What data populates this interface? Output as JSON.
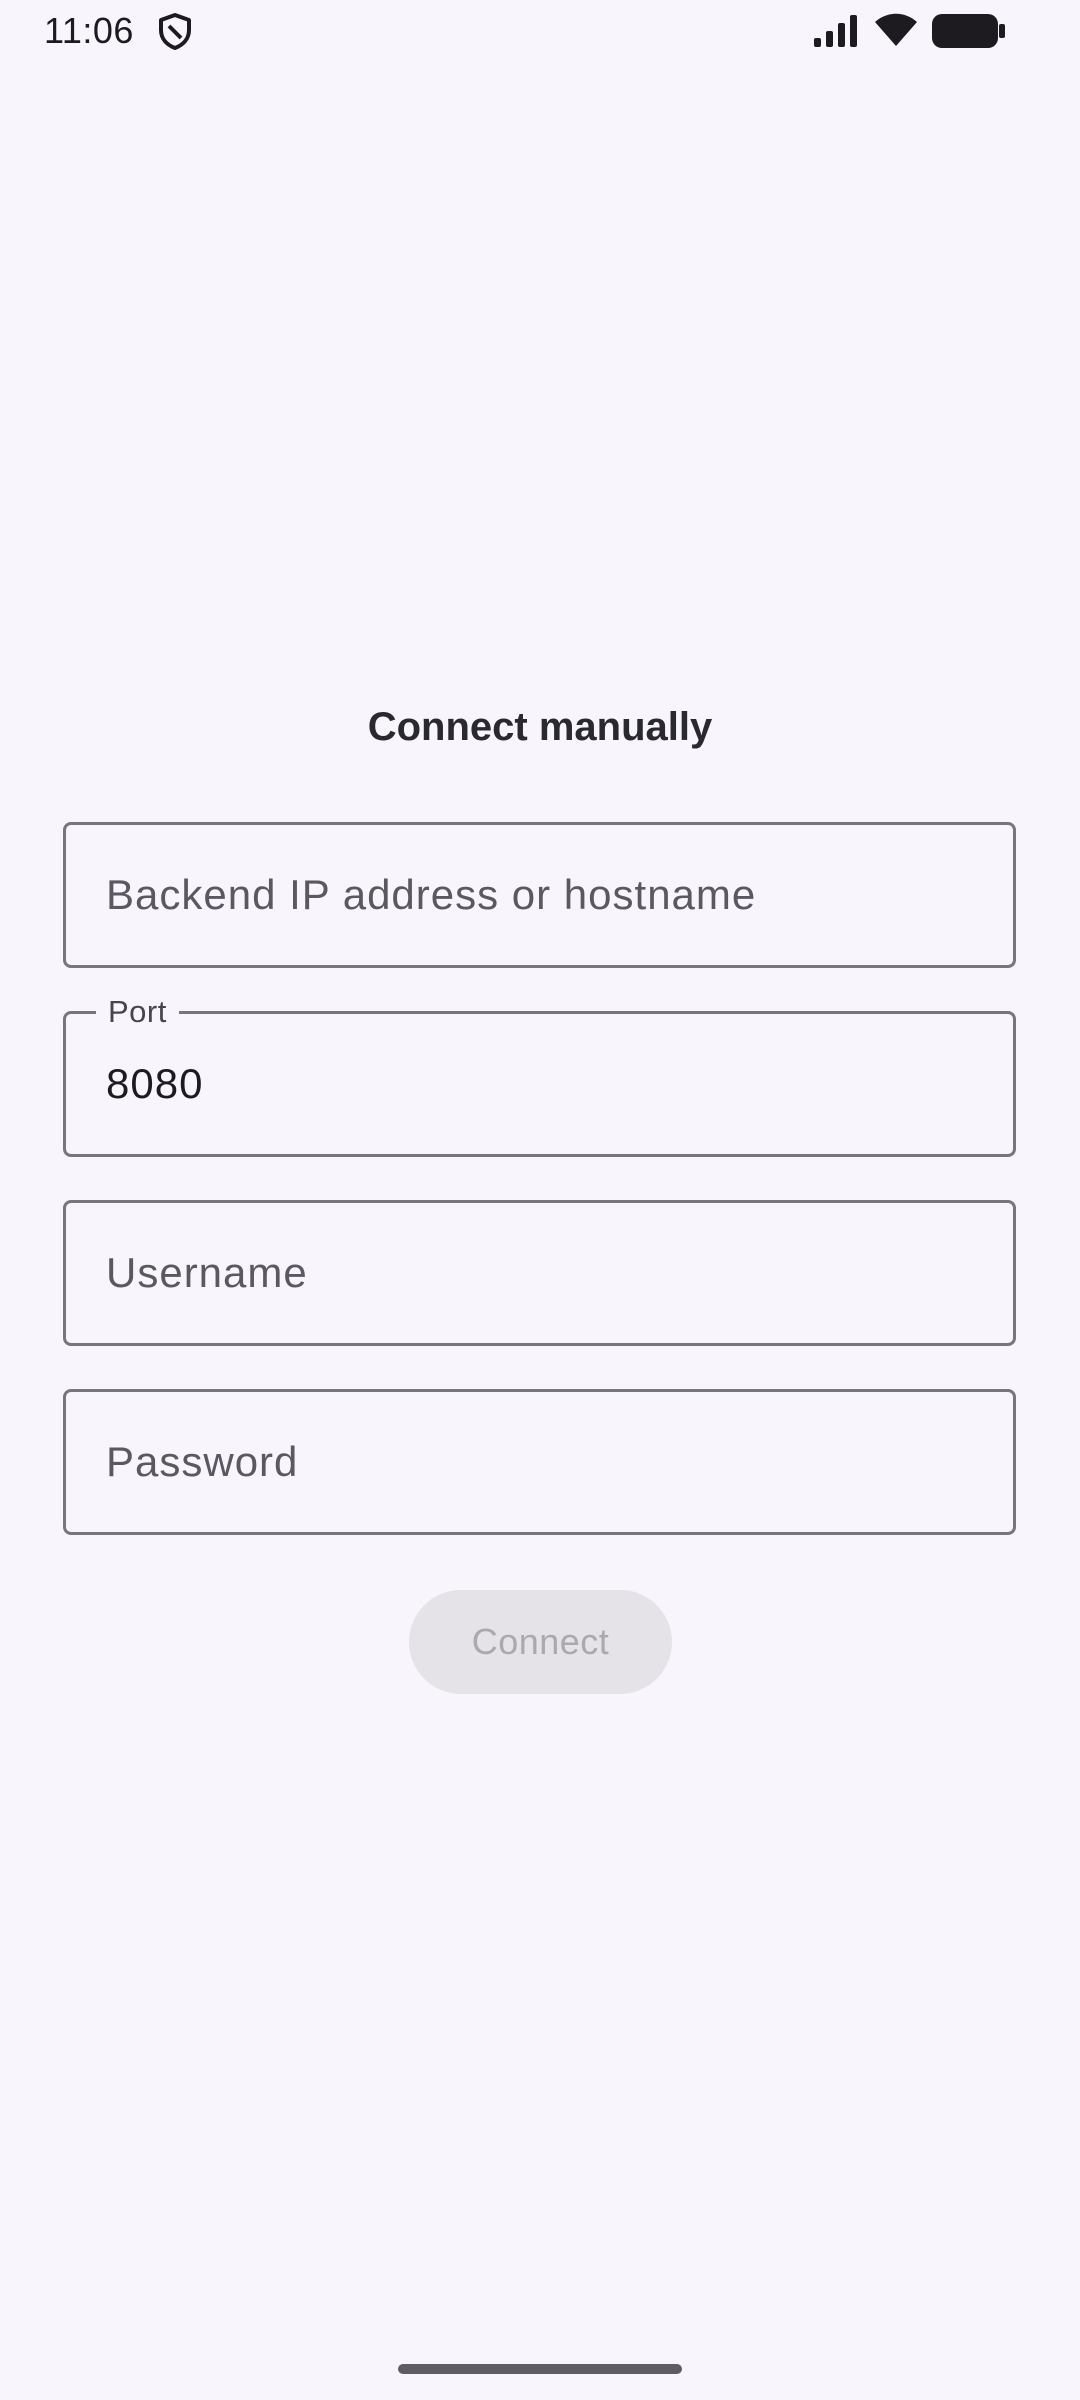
{
  "status_bar": {
    "time": "11:06",
    "icons": [
      "shield-icon",
      "signal-icon",
      "wifi-icon",
      "battery-icon"
    ]
  },
  "screen": {
    "title": "Connect manually"
  },
  "form": {
    "host": {
      "placeholder": "Backend IP address or hostname",
      "value": ""
    },
    "port": {
      "label": "Port",
      "value": "8080"
    },
    "username": {
      "placeholder": "Username",
      "value": ""
    },
    "password": {
      "placeholder": "Password",
      "value": ""
    },
    "connect_label": "Connect",
    "connect_enabled": false
  },
  "colors": {
    "background": "#f8f5fc",
    "outline": "#79747e",
    "disabled_button_bg": "#e5e2e8",
    "disabled_button_text": "#aba8b0"
  }
}
